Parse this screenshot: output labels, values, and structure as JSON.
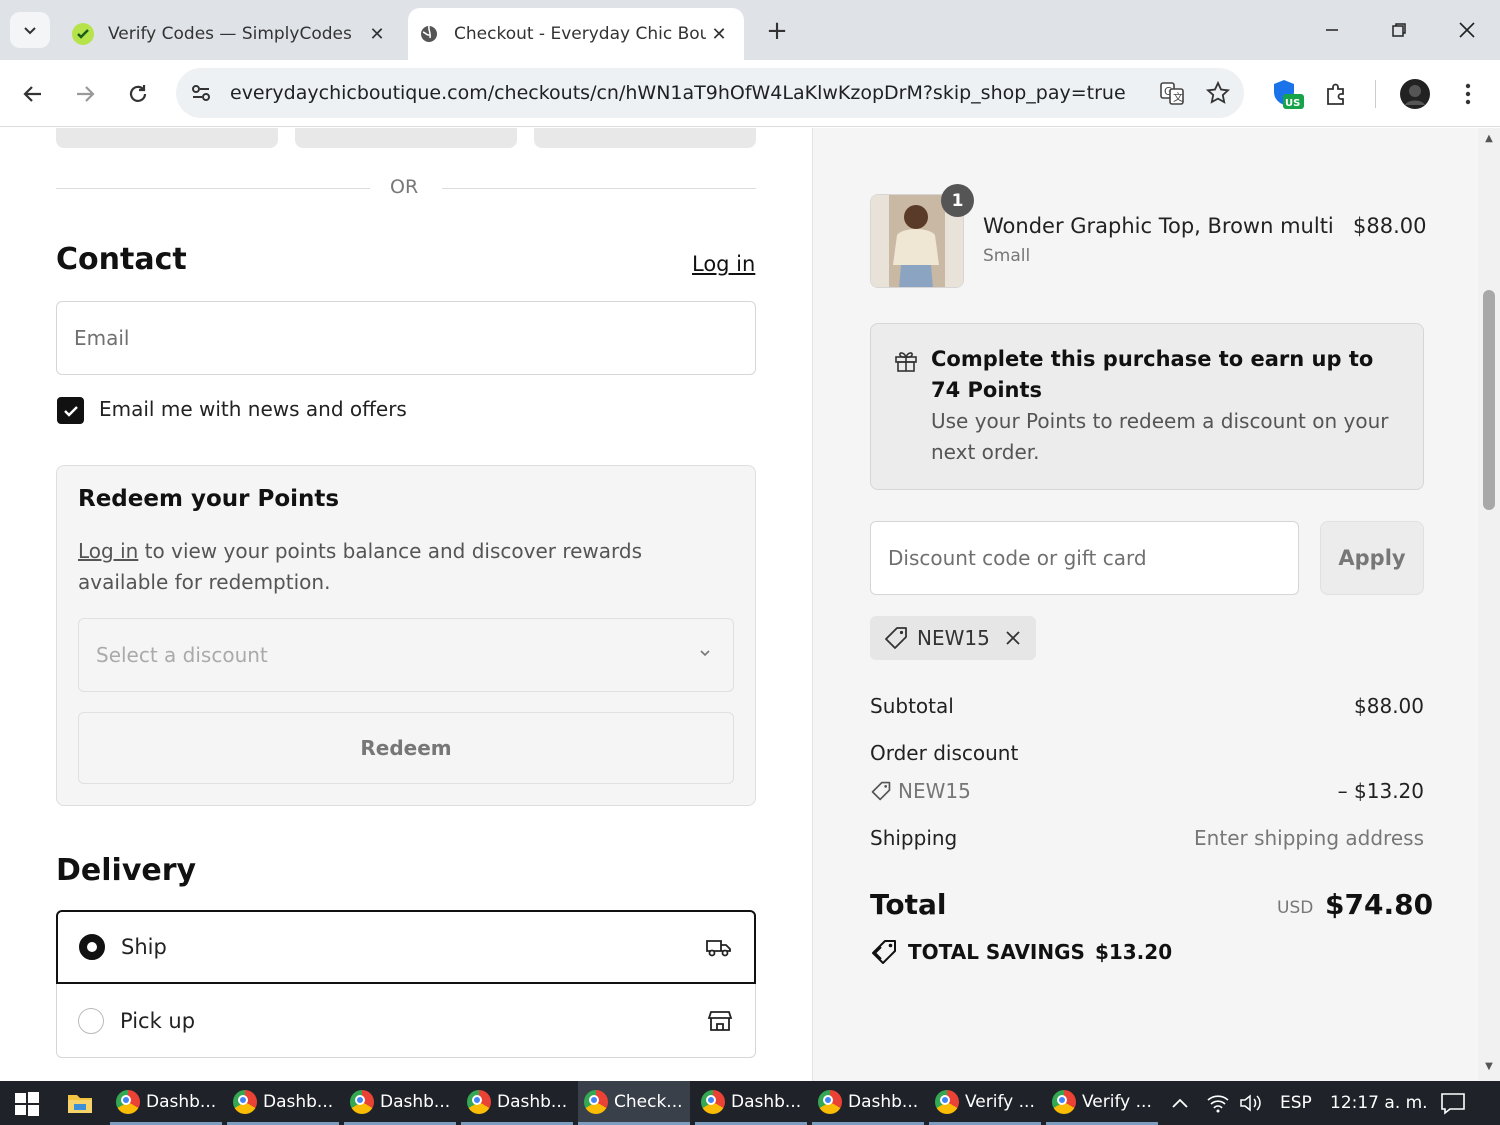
{
  "browser": {
    "tabs": [
      {
        "title": "Verify Codes — SimplyCodes",
        "active": false
      },
      {
        "title": "Checkout - Everyday Chic Bouti",
        "active": true
      }
    ],
    "url": "everydaychicboutique.com/checkouts/cn/hWN1aT9hOfW4LaKlwKzopDrM?skip_shop_pay=true",
    "extension_badge": "US"
  },
  "checkout": {
    "or_text": "OR",
    "contact": {
      "heading": "Contact",
      "login_link": "Log in",
      "email_placeholder": "Email",
      "newsletter_label": "Email me with news and offers",
      "newsletter_checked": true
    },
    "redeem_points": {
      "heading": "Redeem your Points",
      "login_link": "Log in",
      "description": " to view your points balance and discover rewards available for redemption.",
      "select_placeholder": "Select a discount",
      "redeem_button": "Redeem"
    },
    "delivery": {
      "heading": "Delivery",
      "options": [
        {
          "label": "Ship",
          "selected": true,
          "icon": "truck-icon"
        },
        {
          "label": "Pick up",
          "selected": false,
          "icon": "store-icon"
        }
      ]
    }
  },
  "summary": {
    "product": {
      "name": "Wonder Graphic Top, Brown multi",
      "variant": "Small",
      "price": "$88.00",
      "quantity": "1"
    },
    "points_promo": {
      "title": "Complete this purchase to earn up to 74 Points",
      "description": "Use your Points to redeem a discount on your next order."
    },
    "discount_placeholder": "Discount code or gift card",
    "apply_button": "Apply",
    "applied_code": "NEW15",
    "subtotal_label": "Subtotal",
    "subtotal_value": "$88.00",
    "order_discount_label": "Order discount",
    "discount_code": "NEW15",
    "discount_value": "– $13.20",
    "shipping_label": "Shipping",
    "shipping_value": "Enter shipping address",
    "total_label": "Total",
    "currency": "USD",
    "total_value": "$74.80",
    "savings_label": "TOTAL SAVINGS",
    "savings_value": "$13.20"
  },
  "taskbar": {
    "items": [
      {
        "label": "Dashb...",
        "active": false
      },
      {
        "label": "Dashb...",
        "active": false
      },
      {
        "label": "Dashb...",
        "active": false
      },
      {
        "label": "Dashb...",
        "active": false
      },
      {
        "label": "Check...",
        "active": true
      },
      {
        "label": "Dashb...",
        "active": false
      },
      {
        "label": "Dashb...",
        "active": false
      },
      {
        "label": "Verify ...",
        "active": false
      },
      {
        "label": "Verify ...",
        "active": false
      }
    ],
    "language": "ESP",
    "clock": "12:17 a. m."
  },
  "colors": {
    "accent": "#111111",
    "summary_bg": "#f5f5f5",
    "taskbar_bg": "#1f2329"
  }
}
